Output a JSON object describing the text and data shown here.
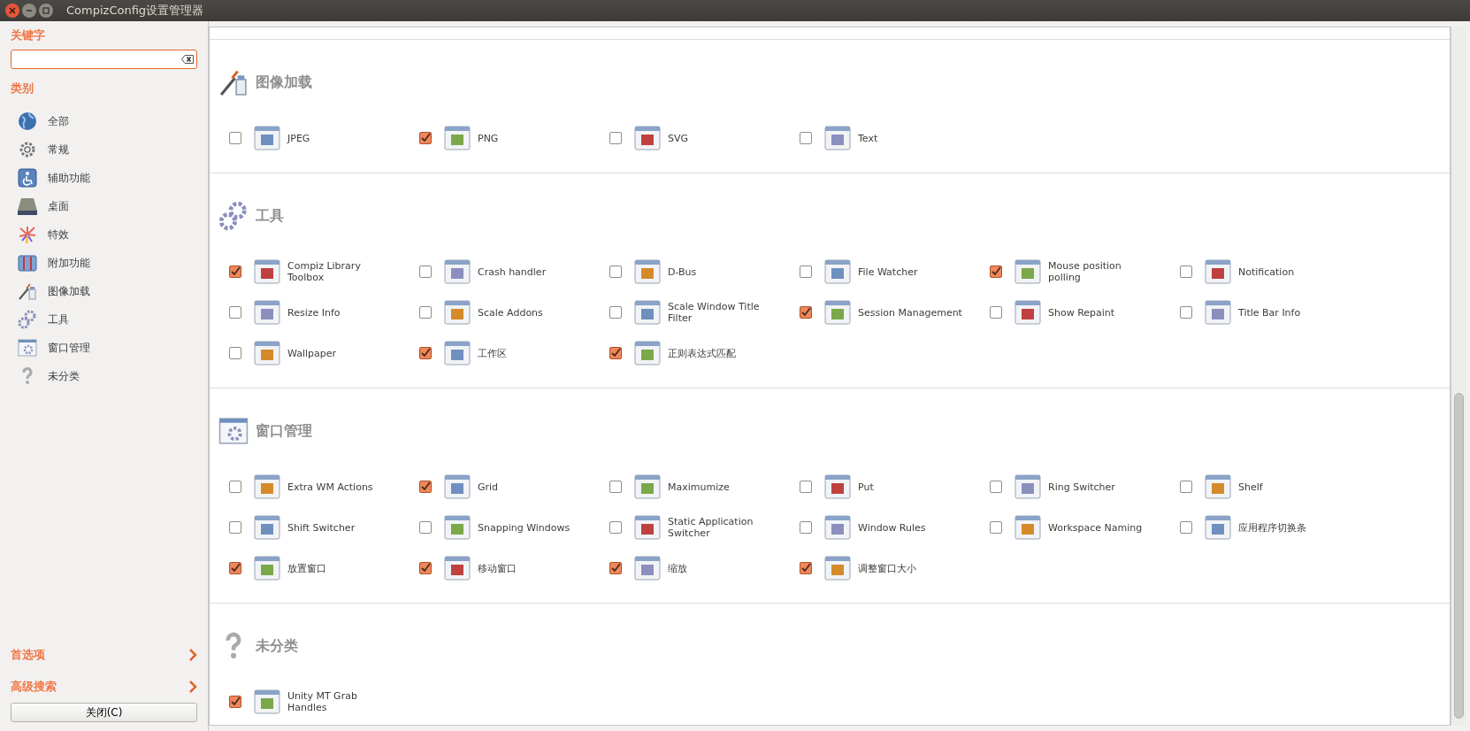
{
  "window": {
    "title": "CompizConfig设置管理器"
  },
  "sidebar": {
    "keyword_label": "关键字",
    "category_label": "类别",
    "categories": [
      {
        "label": "全部"
      },
      {
        "label": "常规"
      },
      {
        "label": "辅助功能"
      },
      {
        "label": "桌面"
      },
      {
        "label": "特效"
      },
      {
        "label": "附加功能"
      },
      {
        "label": "图像加载"
      },
      {
        "label": "工具"
      },
      {
        "label": "窗口管理"
      },
      {
        "label": "未分类"
      }
    ],
    "links": [
      {
        "label": "首选项"
      },
      {
        "label": "高级搜索"
      }
    ],
    "close_button": "关闭(C)"
  },
  "sections": [
    {
      "title": "图像加载",
      "plugins": [
        {
          "label": "JPEG",
          "checked": false
        },
        {
          "label": "PNG",
          "checked": true
        },
        {
          "label": "SVG",
          "checked": false
        },
        {
          "label": "Text",
          "checked": false
        }
      ]
    },
    {
      "title": "工具",
      "plugins": [
        {
          "label": "Compiz Library Toolbox",
          "checked": true
        },
        {
          "label": "Crash handler",
          "checked": false
        },
        {
          "label": "D-Bus",
          "checked": false
        },
        {
          "label": "File Watcher",
          "checked": false
        },
        {
          "label": "Mouse position polling",
          "checked": true
        },
        {
          "label": "Notification",
          "checked": false
        },
        {
          "label": "Resize Info",
          "checked": false
        },
        {
          "label": "Scale Addons",
          "checked": false
        },
        {
          "label": "Scale Window Title Filter",
          "checked": false
        },
        {
          "label": "Session Management",
          "checked": true
        },
        {
          "label": "Show Repaint",
          "checked": false
        },
        {
          "label": "Title Bar Info",
          "checked": false
        },
        {
          "label": "Wallpaper",
          "checked": false
        },
        {
          "label": "工作区",
          "checked": true
        },
        {
          "label": "正则表达式匹配",
          "checked": true
        }
      ]
    },
    {
      "title": "窗口管理",
      "plugins": [
        {
          "label": "Extra WM Actions",
          "checked": false
        },
        {
          "label": "Grid",
          "checked": true
        },
        {
          "label": "Maximumize",
          "checked": false
        },
        {
          "label": "Put",
          "checked": false
        },
        {
          "label": "Ring Switcher",
          "checked": false
        },
        {
          "label": "Shelf",
          "checked": false
        },
        {
          "label": "Shift Switcher",
          "checked": false
        },
        {
          "label": "Snapping Windows",
          "checked": false
        },
        {
          "label": "Static Application Switcher",
          "checked": false
        },
        {
          "label": "Window Rules",
          "checked": false
        },
        {
          "label": "Workspace Naming",
          "checked": false
        },
        {
          "label": "应用程序切换条",
          "checked": false
        },
        {
          "label": "放置窗口",
          "checked": true
        },
        {
          "label": "移动窗口",
          "checked": true
        },
        {
          "label": "缩放",
          "checked": true
        },
        {
          "label": "调整窗口大小",
          "checked": true
        }
      ]
    },
    {
      "title": "未分类",
      "plugins": [
        {
          "label": "Unity MT Grab Handles",
          "checked": true
        }
      ]
    }
  ]
}
